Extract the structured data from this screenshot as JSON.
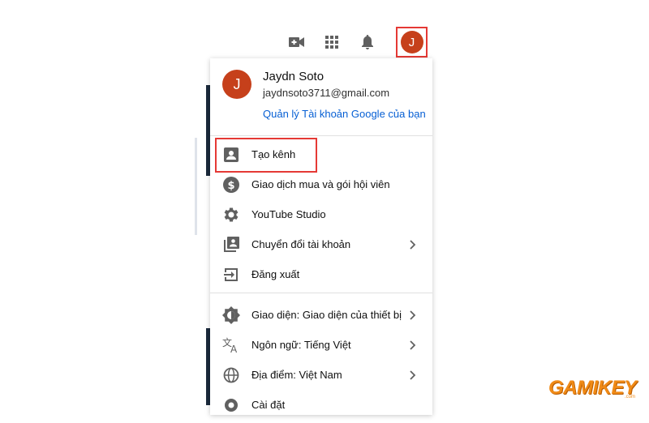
{
  "topbar": {
    "create_icon": "video-plus-icon",
    "apps_icon": "grid-icon",
    "notifications_icon": "bell-icon",
    "avatar_initial": "J"
  },
  "account": {
    "avatar_initial": "J",
    "name": "Jaydn Soto",
    "email": "jaydnsoto3711@gmail.com",
    "manage_link": "Quản lý Tài khoản Google của bạn"
  },
  "menu": {
    "section1": [
      {
        "label": "Tạo kênh",
        "icon": "account-box-icon",
        "chevron": false
      },
      {
        "label": "Giao dịch mua và gói hội viên",
        "icon": "dollar-circle-icon",
        "chevron": false
      },
      {
        "label": "YouTube Studio",
        "icon": "gear-icon",
        "chevron": false
      },
      {
        "label": "Chuyển đổi tài khoản",
        "icon": "switch-account-icon",
        "chevron": true
      },
      {
        "label": "Đăng xuất",
        "icon": "sign-out-icon",
        "chevron": false
      }
    ],
    "section2": [
      {
        "label": "Giao diện: Giao diện của thiết bị",
        "icon": "appearance-icon",
        "chevron": true
      },
      {
        "label": "Ngôn ngữ: Tiếng Việt",
        "icon": "translate-icon",
        "chevron": true
      },
      {
        "label": "Địa điểm: Việt Nam",
        "icon": "globe-icon",
        "chevron": true
      },
      {
        "label": "Cài đặt",
        "icon": "gear-icon",
        "chevron": false
      }
    ]
  },
  "colors": {
    "avatar": "#c6401b",
    "link": "#065fd4",
    "highlight": "#e53935",
    "watermark": "#f08a16"
  },
  "watermark": {
    "text": "GAMIKEY",
    "sub": ".com"
  }
}
